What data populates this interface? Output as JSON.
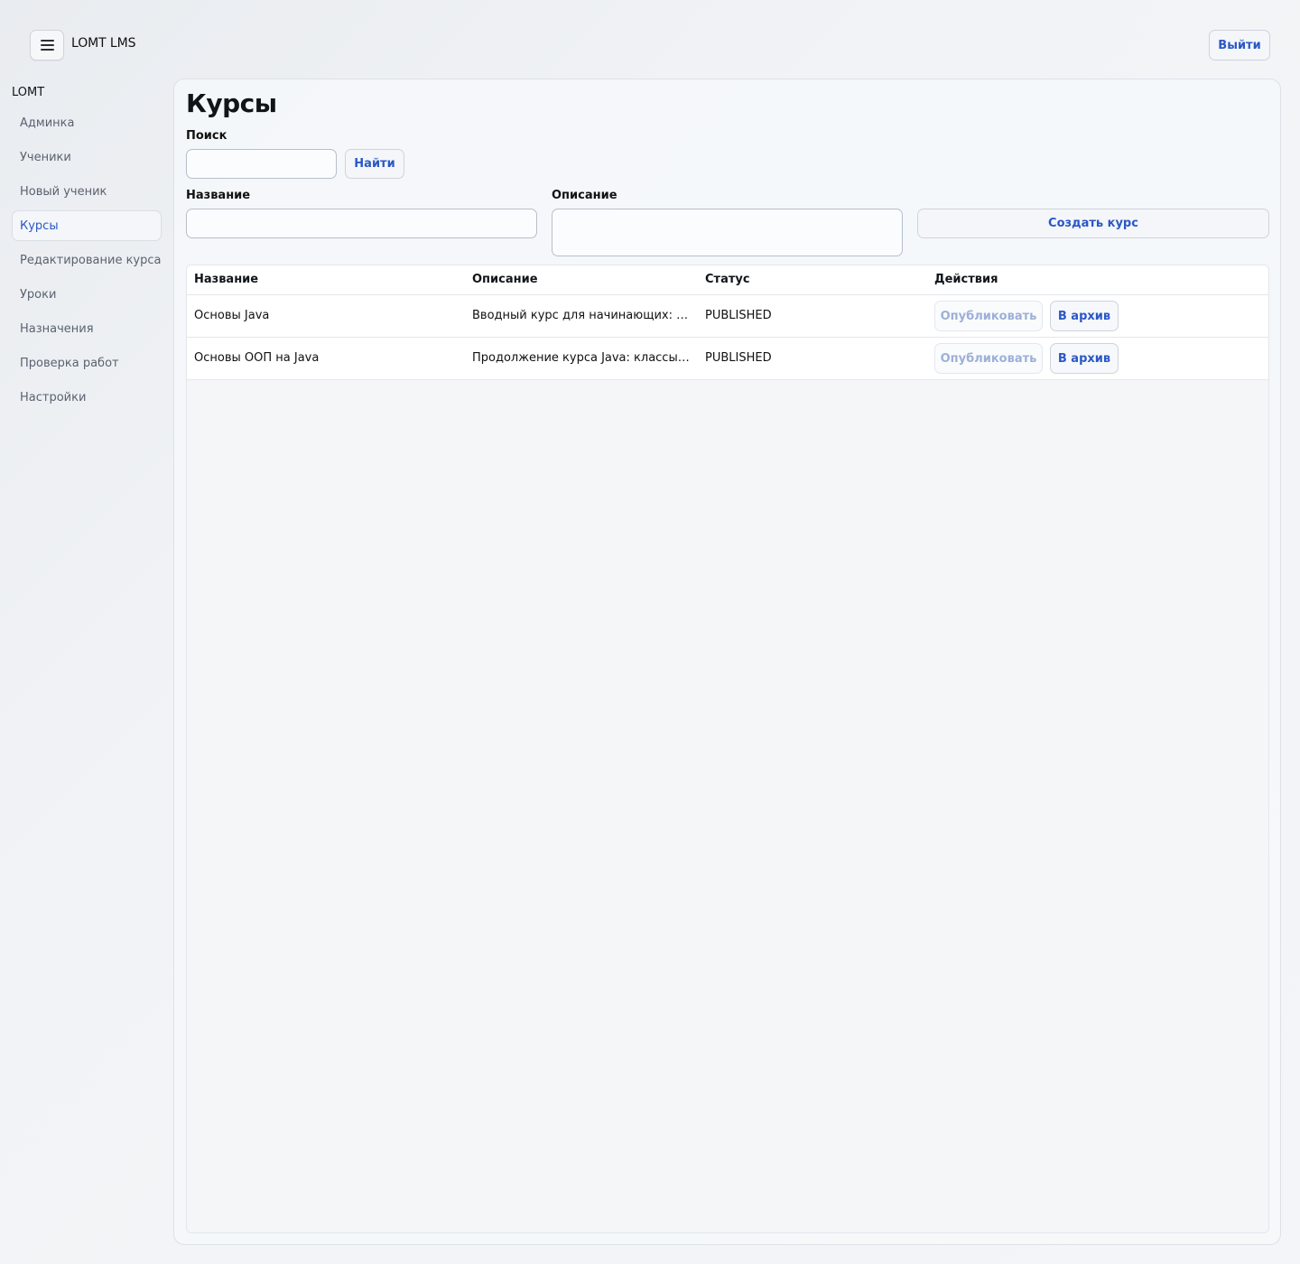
{
  "header": {
    "app_title": "LOMT LMS",
    "logout_label": "Выйти"
  },
  "sidebar": {
    "title": "LOMT",
    "items": [
      {
        "label": "Админка",
        "active": false
      },
      {
        "label": "Ученики",
        "active": false
      },
      {
        "label": "Новый ученик",
        "active": false
      },
      {
        "label": "Курсы",
        "active": true
      },
      {
        "label": "Редактирование курса",
        "active": false
      },
      {
        "label": "Уроки",
        "active": false
      },
      {
        "label": "Назначения",
        "active": false
      },
      {
        "label": "Проверка работ",
        "active": false
      },
      {
        "label": "Настройки",
        "active": false
      }
    ]
  },
  "main": {
    "title": "Курсы",
    "search": {
      "label": "Поиск",
      "value": "",
      "button_label": "Найти"
    },
    "create": {
      "name_label": "Название",
      "name_value": "",
      "description_label": "Описание",
      "description_value": "",
      "create_button_label": "Создать курс"
    },
    "table": {
      "headers": [
        "Название",
        "Описание",
        "Статус",
        "Действия"
      ],
      "rows": [
        {
          "name": "Основы Java",
          "description": "Вводный курс для начинающих: синтаксис, типы данных, условия, циклы",
          "status": "PUBLISHED",
          "publish_label": "Опубликовать",
          "archive_label": "В архив"
        },
        {
          "name": "Основы ООП на Java",
          "description": "Продолжение курса Java: классы, объекты, наследование, полиморфизм",
          "status": "PUBLISHED",
          "publish_label": "Опубликовать",
          "archive_label": "В архив"
        }
      ]
    }
  },
  "colors": {
    "accent": "#2a58c6",
    "disabled_text": "#9db0d8"
  }
}
